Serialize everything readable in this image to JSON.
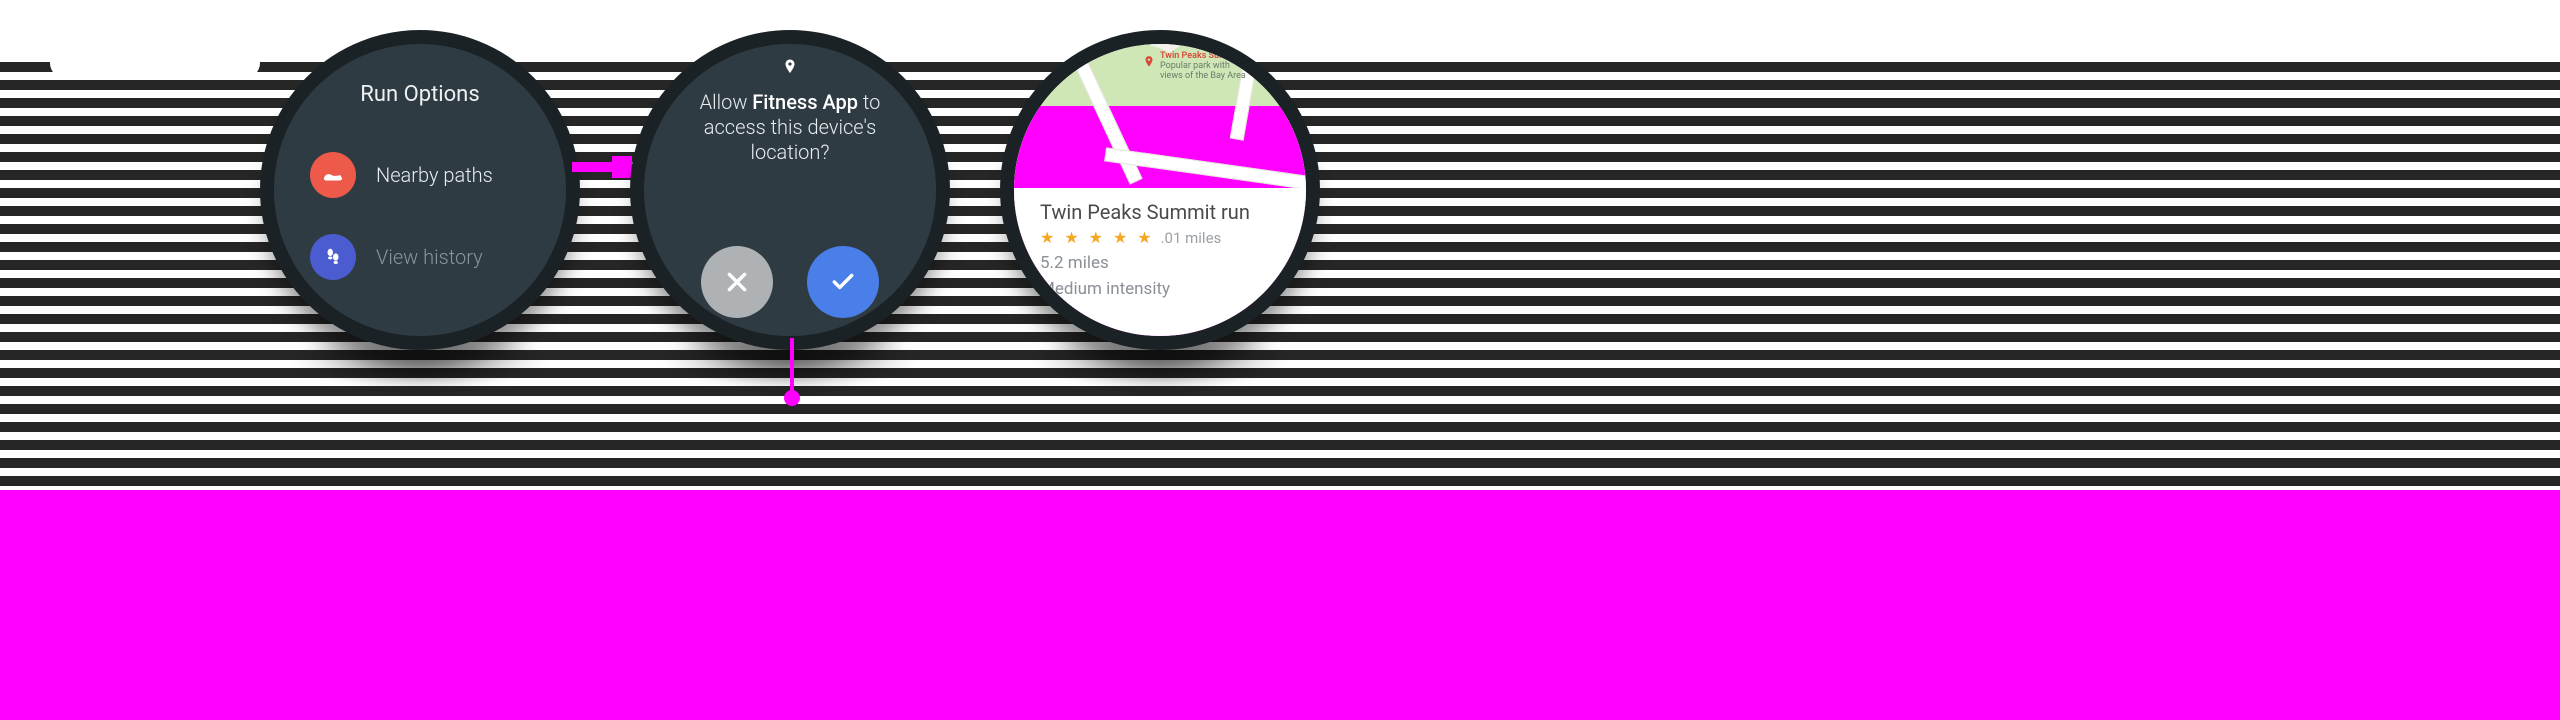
{
  "watch1": {
    "title": "Run Options",
    "items": [
      {
        "label": "Nearby paths",
        "icon": "shoe-icon",
        "color": "red"
      },
      {
        "label": "View history",
        "icon": "footsteps-icon",
        "color": "blue"
      }
    ]
  },
  "watch2": {
    "prompt_pre": "Allow ",
    "prompt_app": "Fitness App",
    "prompt_post": " to access this device's location?",
    "deny_label": "Deny",
    "allow_label": "Allow"
  },
  "watch3": {
    "marker": {
      "title": "Twin Peaks Summit",
      "subtitle1": "Popular park with",
      "subtitle2": "views of the Bay Area"
    },
    "card": {
      "title": "Twin Peaks Summit run",
      "stars": 5,
      "distance_small": ".01 miles",
      "line1": "5.2 miles",
      "line2": "Medium intensity"
    }
  }
}
